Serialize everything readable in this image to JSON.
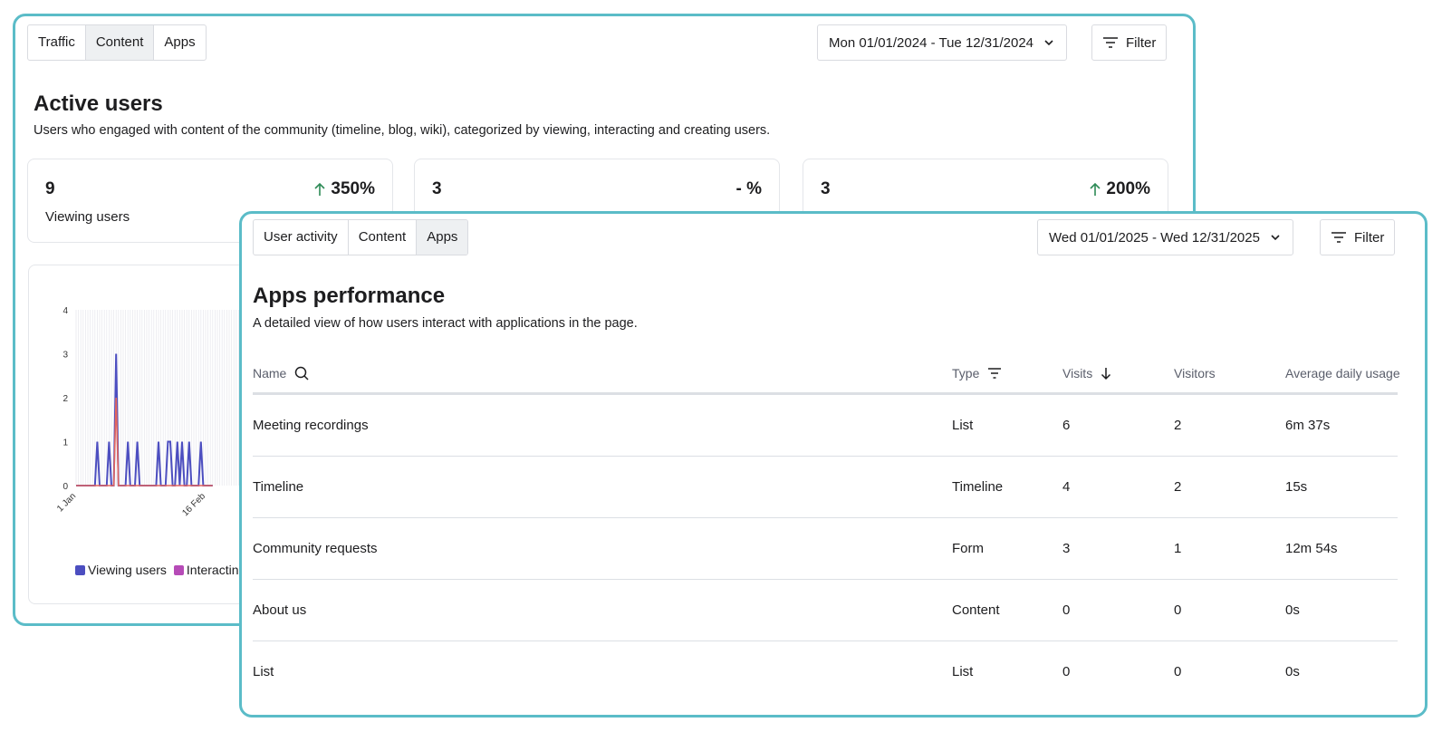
{
  "back_panel": {
    "tabs": [
      {
        "label": "Traffic",
        "active": false
      },
      {
        "label": "Content",
        "active": true
      },
      {
        "label": "Apps",
        "active": false
      }
    ],
    "date_range": "Mon 01/01/2024 - Tue 12/31/2024",
    "filter_label": "Filter",
    "title": "Active users",
    "subtitle": "Users who engaged with content of the community (timeline, blog, wiki), categorized by viewing, interacting and creating users.",
    "stats": [
      {
        "value": "9",
        "change": "350%",
        "trend": "up",
        "label": "Viewing users"
      },
      {
        "value": "3",
        "change": "- %",
        "trend": "none",
        "label": ""
      },
      {
        "value": "3",
        "change": "200%",
        "trend": "up",
        "label": ""
      }
    ],
    "chart_data": {
      "type": "line",
      "x": [
        "1 Jan",
        "16 Feb"
      ],
      "ylim": [
        0,
        4
      ],
      "y_ticks": [
        "0",
        "1",
        "2",
        "3",
        "4"
      ],
      "series": [
        {
          "name": "Viewing users",
          "color": "#4c4ec0",
          "values": [
            0,
            0,
            0,
            0,
            0,
            0,
            0,
            0,
            0,
            1,
            0,
            0,
            0,
            0,
            1,
            0,
            0,
            3,
            0,
            0,
            0,
            0,
            1,
            0,
            0,
            0,
            1,
            0,
            0,
            0,
            0,
            0,
            0,
            0,
            0,
            1,
            0,
            0,
            0,
            1,
            1,
            0,
            0,
            1,
            0,
            1,
            0,
            0,
            1,
            0,
            0,
            0,
            0,
            1,
            0,
            0,
            0,
            0,
            0
          ]
        },
        {
          "name": "Interacting users",
          "color": "#e5675e",
          "values": [
            0,
            0,
            0,
            0,
            0,
            0,
            0,
            0,
            0,
            0,
            0,
            0,
            0,
            0,
            0,
            0,
            0,
            2,
            0,
            0,
            0,
            0,
            0,
            0,
            0,
            0,
            0,
            0,
            0,
            0,
            0,
            0,
            0,
            0,
            0,
            0,
            0,
            0,
            0,
            0,
            0,
            0,
            0,
            0,
            0,
            0,
            0,
            0,
            0,
            0,
            0,
            0,
            0,
            0,
            0,
            0,
            0,
            0,
            0
          ]
        }
      ],
      "legend": [
        {
          "label": "Viewing users",
          "color": "#4c4ec0"
        },
        {
          "label": "Interactin",
          "color": "#b64bb7"
        }
      ],
      "grid": true
    }
  },
  "front_panel": {
    "tabs": [
      {
        "label": "User activity",
        "active": false
      },
      {
        "label": "Content",
        "active": false
      },
      {
        "label": "Apps",
        "active": true
      }
    ],
    "date_range": "Wed 01/01/2025 - Wed 12/31/2025",
    "filter_label": "Filter",
    "title": "Apps performance",
    "subtitle": "A detailed view of how users interact with applications in the page.",
    "table": {
      "columns": {
        "name": "Name",
        "type": "Type",
        "visits": "Visits",
        "visitors": "Visitors",
        "avg": "Average daily usage"
      },
      "rows": [
        {
          "name": "Meeting recordings",
          "type": "List",
          "visits": "6",
          "visitors": "2",
          "avg": "6m 37s"
        },
        {
          "name": "Timeline",
          "type": "Timeline",
          "visits": "4",
          "visitors": "2",
          "avg": "15s"
        },
        {
          "name": "Community requests",
          "type": "Form",
          "visits": "3",
          "visitors": "1",
          "avg": "12m 54s"
        },
        {
          "name": "About us",
          "type": "Content",
          "visits": "0",
          "visitors": "0",
          "avg": "0s"
        },
        {
          "name": "List",
          "type": "List",
          "visits": "0",
          "visitors": "0",
          "avg": "0s"
        }
      ]
    }
  },
  "colors": {
    "panel_border": "#5bbcc8",
    "trend_up": "#2e8b57",
    "active_tab": "#eef0f2"
  }
}
